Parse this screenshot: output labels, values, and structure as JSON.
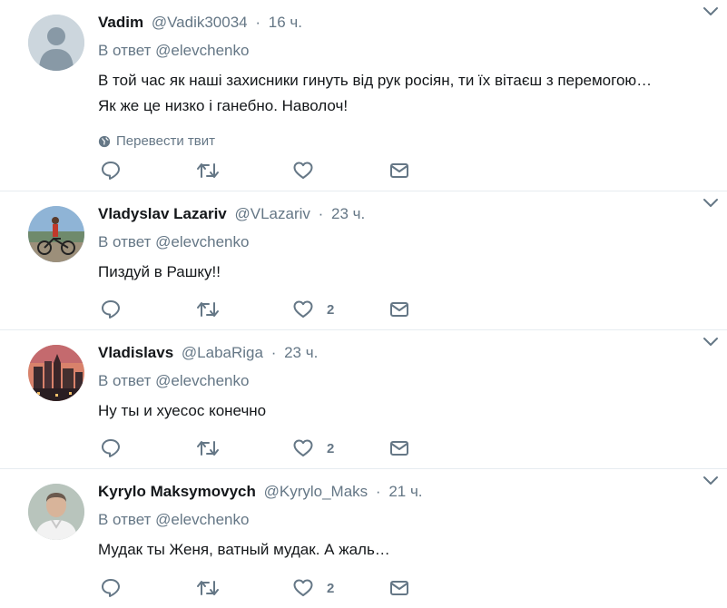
{
  "tweets": [
    {
      "name": "Vadim",
      "handle": "@Vadik30034",
      "separator": "·",
      "time": "16 ч.",
      "reply_to": "В ответ @elevchenko",
      "text_lines": [
        "В той час як наші захисники гинуть від рук росіян, ти їх вітаєш з перемогою…",
        "Як же це низко і ганебно. Наволоч!"
      ],
      "translate_label": "Перевести твит",
      "avatar": "default-avatar",
      "like_count": ""
    },
    {
      "name": "Vladyslav Lazariv",
      "handle": "@VLazariv",
      "separator": "·",
      "time": "23 ч.",
      "reply_to": "В ответ @elevchenko",
      "text_lines": [
        "Пиздуй в Рашку!!"
      ],
      "avatar": "cyclist-avatar",
      "like_count": "2"
    },
    {
      "name": "Vladislavs",
      "handle": "@LabaRiga",
      "separator": "·",
      "time": "23 ч.",
      "reply_to": "В ответ @elevchenko",
      "text_lines": [
        "Ну ты и хуесос конечно"
      ],
      "avatar": "cityscape-avatar",
      "like_count": "2"
    },
    {
      "name": "Kyrylo Maksymovych",
      "handle": "@Kyrylo_Maks",
      "separator": "·",
      "time": "21 ч.",
      "reply_to": "В ответ @elevchenko",
      "text_lines": [
        "Мудак ты Женя, ватный мудак. А жаль…"
      ],
      "avatar": "portrait-avatar",
      "like_count": "2"
    }
  ],
  "icons": {
    "reply": "reply-icon",
    "retweet": "retweet-icon",
    "like": "heart-icon",
    "dm": "envelope-icon",
    "caret": "chevron-down-icon",
    "globe": "globe-icon"
  },
  "colors": {
    "icon": "#657786",
    "name": "#14171a",
    "secondary": "#657786",
    "divider": "#e6ecf0"
  }
}
